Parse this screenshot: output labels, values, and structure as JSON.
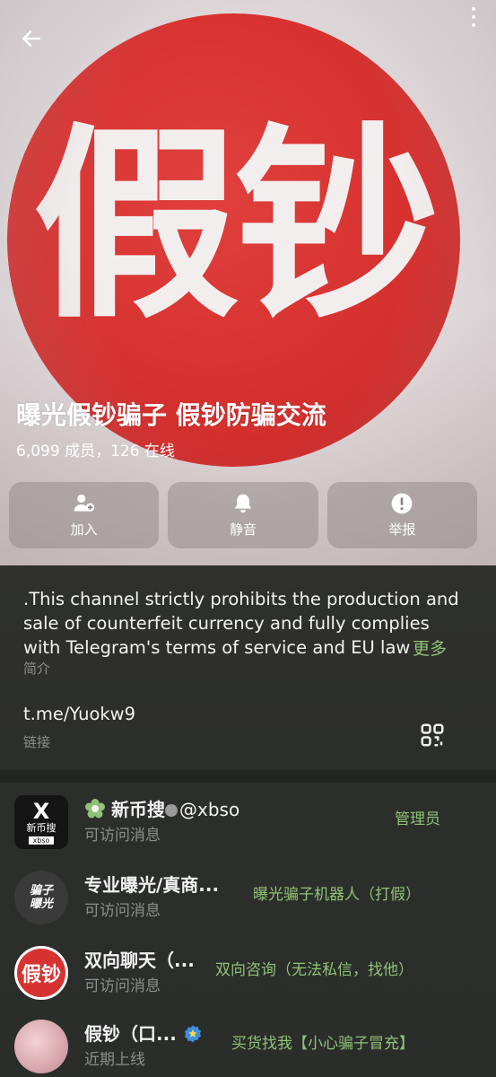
{
  "header": {
    "back_icon": "arrow-left-icon",
    "more_icon": "vertical-dots-icon"
  },
  "avatar": {
    "text": "假钞",
    "color": "#d6312f"
  },
  "channel": {
    "title": "曝光假钞骗子 假钞防骗交流",
    "meta": "6,099 成员，126 在线"
  },
  "actions": [
    {
      "label": "加入",
      "icon": "add-user-icon"
    },
    {
      "label": "静音",
      "icon": "bell-icon"
    },
    {
      "label": "举报",
      "icon": "alert-icon"
    }
  ],
  "about": {
    "text": ".This channel strictly prohibits the production and sale of counterfeit currency and fully complies with Telegram's terms of service and EU law",
    "more": "更多",
    "label": "简介"
  },
  "link": {
    "value": "t.me/Yuokw9",
    "label": "链接",
    "qr_icon": "qr-code-icon"
  },
  "members": [
    {
      "name": "新币搜",
      "handle": "@xbso",
      "sub": "可访问消息",
      "role": "管理员",
      "avatar_cn": "新币搜",
      "avatar_tag": "xbso"
    },
    {
      "name": "专业曝光/真商...",
      "sub": "可访问消息",
      "role": "曝光骗子机器人（打假）",
      "avatar_line1": "骗子",
      "avatar_line2": "曝光"
    },
    {
      "name": "双向聊天（...",
      "sub": "可访问消息",
      "role": "双向咨询（无法私信，找他）",
      "avatar_text": "假钞"
    },
    {
      "name": "假钞（口...",
      "sub": "近期上线",
      "role": "买货找我【小心骗子冒充】"
    }
  ],
  "colors": {
    "accent_green": "#8fc276",
    "muted_text": "#8b8e8a",
    "panel_bg": "#2c2e2b"
  }
}
